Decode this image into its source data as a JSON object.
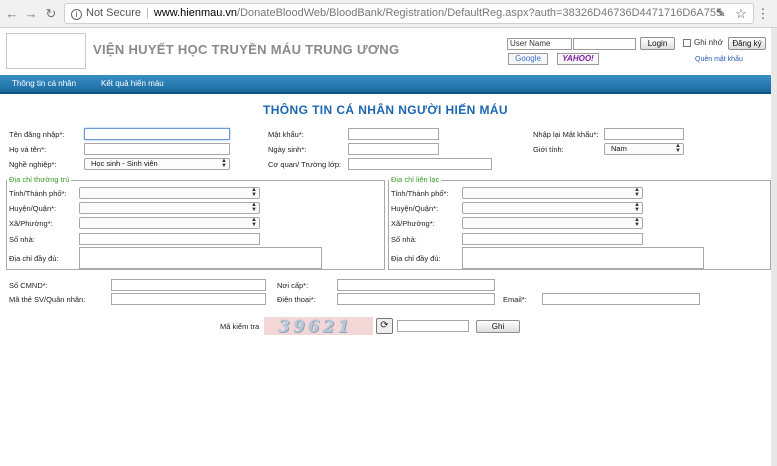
{
  "browser": {
    "security_label": "Not Secure",
    "domain": "www.hienmau.vn",
    "path": "/DonateBloodWeb/BloodBank/Registration/DefaultReg.aspx?auth=38326D46736D4471716D6A755"
  },
  "header": {
    "site_title": "VIỆN HUYẾT HỌC TRUYỀN MÁU TRUNG ƯƠNG",
    "username_label": "User Name",
    "login_button": "Login",
    "remember_label": "Ghi nhớ",
    "register_button": "Đăng ký",
    "google_label": "Google",
    "yahoo_label": "YAHOO!",
    "forgot_password": "Quên mật khẩu"
  },
  "menu": {
    "items": [
      "Thông tin cá nhân",
      "Kết quả hiến máu"
    ]
  },
  "form": {
    "title": "THÔNG TIN CÁ NHÂN NGƯỜI HIẾN MÁU",
    "username_label": "Tên đăng nhập*:",
    "password_label": "Mật khẩu*:",
    "confirm_password_label": "Nhập lại Mật khẩu*:",
    "fullname_label": "Họ và tên*:",
    "birthdate_label": "Ngày sinh*:",
    "gender_label": "Giới tính:",
    "gender_value": "Nam",
    "occupation_label": "Nghề nghiệp*:",
    "occupation_value": "Học sinh - Sinh viên",
    "workplace_label": "Cơ quan/ Trường lớp:",
    "permanent_address": {
      "legend": "Địa chỉ thường trú",
      "province_label": "Tỉnh/Thành phố*:",
      "district_label": "Huyện/Quận*:",
      "ward_label": "Xã/Phường*:",
      "house_label": "Số nhà:",
      "full_label": "Địa chỉ đầy đủ:"
    },
    "contact_address": {
      "legend": "Địa chỉ liên lạc",
      "province_label": "Tỉnh/Thành phố*:",
      "district_label": "Huyện/Quận*:",
      "ward_label": "Xã/Phường*:",
      "house_label": "Số nhà:",
      "full_label": "Địa chỉ đầy đủ:"
    },
    "id_label": "Số CMND*:",
    "issued_label": "Nơi cấp*:",
    "student_id_label": "Mã thẻ SV/Quân nhân:",
    "phone_label": "Điện thoại*:",
    "email_label": "Email*:",
    "captcha_label": "Mã kiểm tra",
    "captcha_text": "39621",
    "save_button": "Ghi"
  }
}
